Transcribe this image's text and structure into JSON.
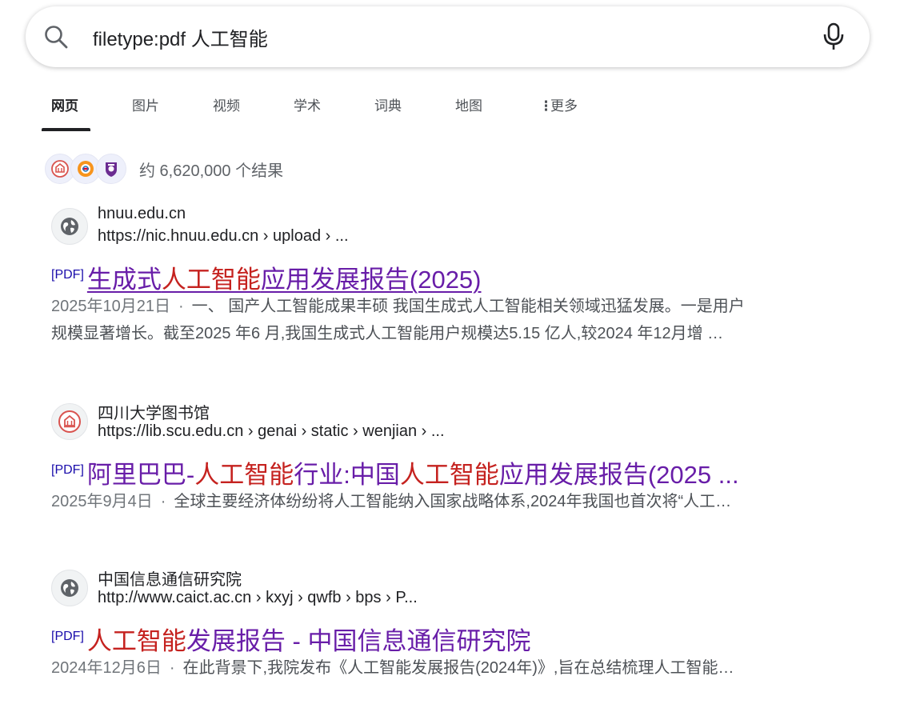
{
  "search": {
    "query": "filetype:pdf 人工智能"
  },
  "tabs": [
    {
      "label": "网页",
      "active": true
    },
    {
      "label": "图片",
      "active": false
    },
    {
      "label": "视频",
      "active": false
    },
    {
      "label": "学术",
      "active": false
    },
    {
      "label": "词典",
      "active": false
    },
    {
      "label": "地图",
      "active": false
    },
    {
      "label": "更多",
      "active": false
    }
  ],
  "stats": {
    "text": "约 6,620,000 个结果"
  },
  "results": [
    {
      "site_name": "hnuu.edu.cn",
      "url": "https://nic.hnuu.edu.cn › upload › ...",
      "pdf_tag": "[PDF]",
      "title_parts": [
        "生成式",
        "人工智能",
        "应用发展报告(2025)"
      ],
      "date": "2025年10月21日",
      "snippet": "一、 国产人工智能成果丰硕 我国生成式人工智能相关领域迅猛发展。一是用户规模显著增长。截至2025 年6 月,我国生成式人工智能用户规模达5.15 亿人,较2024 年12月增 ...",
      "snippet_line1": "一、 国产人工智能成果丰硕 我国生成式人工智能相关领域迅猛发展。一是用户",
      "snippet_line2": "规模显著增长。截至2025 年6 月,我国生成式人工智能用户规模达5.15 亿人,较2024 年12月增 …"
    },
    {
      "site_name": "四川大学图书馆",
      "url": "https://lib.scu.edu.cn › genai › static › wenjian › ...",
      "pdf_tag": "[PDF]",
      "title_parts": [
        "阿里巴巴-",
        "人工智能",
        "行业:中国",
        "人工智能",
        "应用发展报告(2025 ..."
      ],
      "date": "2025年9月4日",
      "snippet": "全球主要经济体纷纷将人工智能纳入国家战略体系,2024年我国也首次将“人工…"
    },
    {
      "site_name": "中国信息通信研究院",
      "url": "http://www.caict.ac.cn › kxyj › qwfb › bps › P...",
      "pdf_tag": "[PDF]",
      "title_parts": [
        "人工智能",
        "发展报告 - 中国信息通信研究院"
      ],
      "date": "2024年12月6日",
      "snippet": "在此背景下,我院发布《人工智能发展报告(2024年)》,旨在总结梳理人工智能…"
    }
  ],
  "colors": {
    "link": "#1a0dab",
    "visited": "#681da8",
    "highlight": "#c5221f",
    "snippet": "#4d5156"
  },
  "icons": {
    "search": "search-icon",
    "mic": "microphone-icon",
    "more": "more-vertical-icon",
    "globe": "globe-icon"
  }
}
